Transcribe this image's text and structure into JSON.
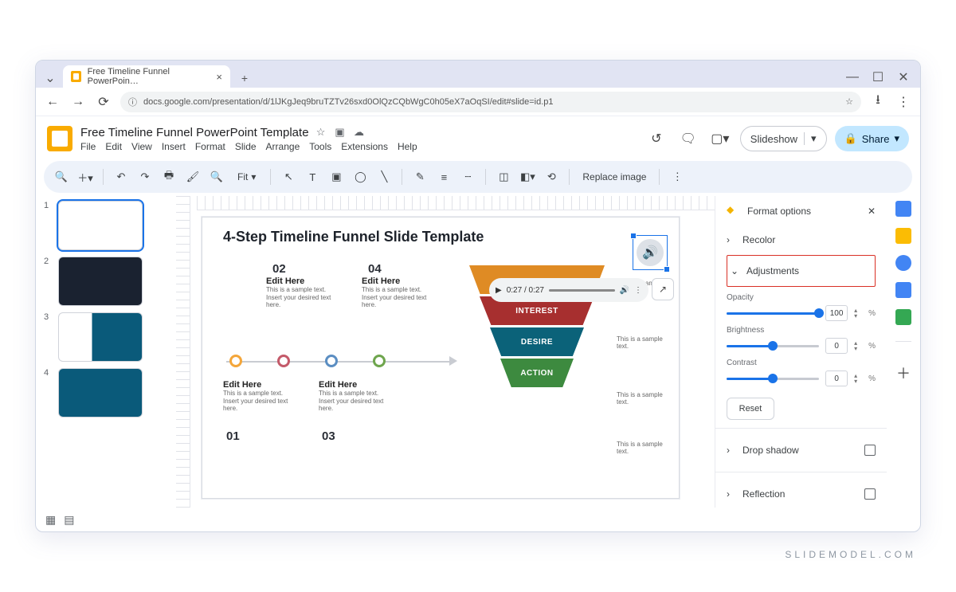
{
  "browser": {
    "tab_title": "Free Timeline Funnel PowerPoin…",
    "url": "docs.google.com/presentation/d/1lJKgJeq9bruTZTv26sxd0OlQzCQbWgC0h05eX7aOqSI/edit#slide=id.p1"
  },
  "doc": {
    "title": "Free Timeline Funnel PowerPoint Template",
    "menus": [
      "File",
      "Edit",
      "View",
      "Insert",
      "Format",
      "Slide",
      "Arrange",
      "Tools",
      "Extensions",
      "Help"
    ],
    "slideshow": "Slideshow",
    "share": "Share"
  },
  "toolbar": {
    "fit": "Fit",
    "replace": "Replace image"
  },
  "thumbnails": {
    "count": 4
  },
  "slide": {
    "title": "4-Step Timeline Funnel Slide Template",
    "tl_num": {
      "n01": "01",
      "n02": "02",
      "n03": "03",
      "n04": "04"
    },
    "edit_here": "Edit Here",
    "sample": "This is a sample text. Insert your desired text here.",
    "funnel": {
      "f2": "INTEREST",
      "f3": "DESIRE",
      "f4": "ACTION"
    },
    "side": "This is a sample text."
  },
  "player": {
    "time": "0:27 / 0:27"
  },
  "format": {
    "title": "Format options",
    "recolor": "Recolor",
    "adjustments": "Adjustments",
    "opacity_label": "Opacity",
    "brightness_label": "Brightness",
    "contrast_label": "Contrast",
    "opacity": "100",
    "brightness": "0",
    "contrast": "0",
    "reset": "Reset",
    "drop_shadow": "Drop shadow",
    "reflection": "Reflection"
  },
  "watermark": "SLIDEMODEL.COM"
}
